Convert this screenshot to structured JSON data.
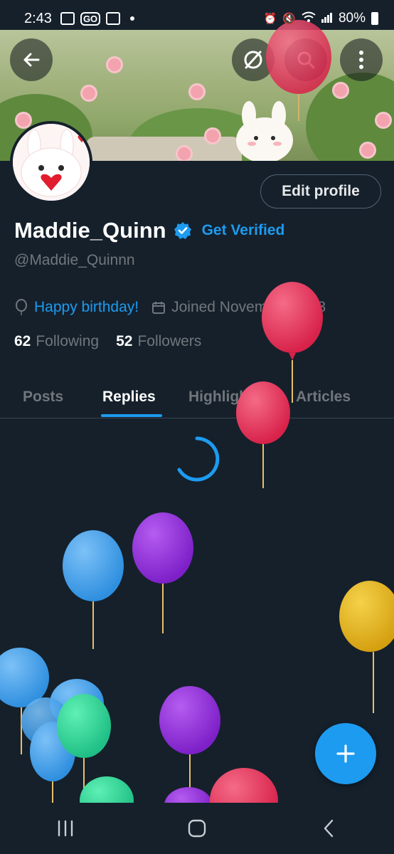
{
  "status_bar": {
    "time": "2:43",
    "go_label": "GO",
    "battery": "80%"
  },
  "profile": {
    "display_name": "Maddie_Quinn",
    "get_verified": "Get Verified",
    "handle": "@Maddie_Quinnn",
    "birthday_text": "Happy birthday!",
    "joined_text": "Joined November 2023",
    "following_count": "62",
    "following_label": "Following",
    "followers_count": "52",
    "followers_label": "Followers",
    "edit_profile_label": "Edit profile"
  },
  "tabs": [
    {
      "label": "Posts"
    },
    {
      "label": "Replies"
    },
    {
      "label": "Highlights"
    },
    {
      "label": "Articles"
    }
  ],
  "icons": {
    "back": "back-arrow-icon",
    "grok": "grok-icon",
    "search": "search-icon",
    "more": "more-vertical-icon",
    "verified": "verified-badge-icon",
    "balloon": "balloon-icon",
    "calendar": "calendar-icon",
    "compose": "plus-icon"
  },
  "colors": {
    "background": "#15202b",
    "accent": "#1d9bf0",
    "muted": "#71767b"
  }
}
